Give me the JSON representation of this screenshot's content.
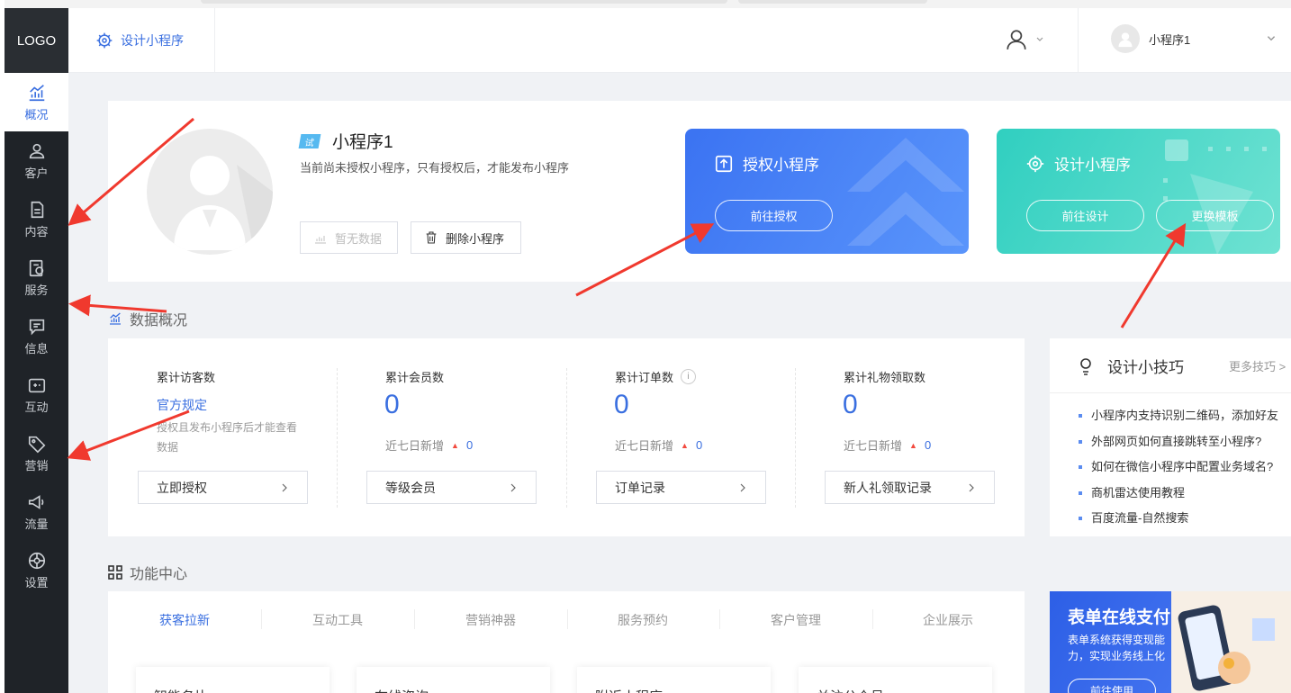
{
  "sidebar": {
    "logo": "LOGO",
    "items": [
      {
        "label": "概况",
        "icon": "chart-icon"
      },
      {
        "label": "客户",
        "icon": "user-icon"
      },
      {
        "label": "内容",
        "icon": "document-icon"
      },
      {
        "label": "服务",
        "icon": "service-icon"
      },
      {
        "label": "信息",
        "icon": "message-icon"
      },
      {
        "label": "互动",
        "icon": "interaction-icon"
      },
      {
        "label": "营销",
        "icon": "tag-icon"
      },
      {
        "label": "流量",
        "icon": "megaphone-icon"
      },
      {
        "label": "设置",
        "icon": "gear-icon"
      }
    ]
  },
  "header": {
    "tab_label": "设计小程序",
    "account_name": "小程序1"
  },
  "profile": {
    "badge": "试",
    "name": "小程序1",
    "desc": "当前尚未授权小程序，只有授权后，才能发布小程序",
    "nodata_label": "暂无数据",
    "delete_label": "删除小程序",
    "auth_card": {
      "title": "授权小程序",
      "button": "前往授权"
    },
    "design_card": {
      "title": "设计小程序",
      "button_design": "前往设计",
      "button_template": "更换模板"
    }
  },
  "data_overview": {
    "title": "数据概况",
    "stats": [
      {
        "label": "累计访客数",
        "rule_link": "官方规定",
        "rule_text": "授权且发布小程序后才能查看数据",
        "button": "立即授权"
      },
      {
        "label": "累计会员数",
        "value": "0",
        "sub": "近七日新增",
        "delta": "0",
        "button": "等级会员"
      },
      {
        "label": "累计订单数",
        "value": "0",
        "sub": "近七日新增",
        "delta": "0",
        "button": "订单记录",
        "info": "i"
      },
      {
        "label": "累计礼物领取数",
        "value": "0",
        "sub": "近七日新增",
        "delta": "0",
        "button": "新人礼领取记录"
      }
    ]
  },
  "tips": {
    "title": "设计小技巧",
    "more": "更多技巧 >",
    "items": [
      "小程序内支持识别二维码，添加好友",
      "外部网页如何直接跳转至小程序?",
      "如何在微信小程序中配置业务域名?",
      "商机雷达使用教程",
      "百度流量-自然搜索"
    ]
  },
  "function_center": {
    "title": "功能中心",
    "tabs": [
      "获客拉新",
      "互动工具",
      "营销神器",
      "服务预约",
      "客户管理",
      "企业展示"
    ],
    "cards": [
      "智能名片",
      "在线咨询",
      "附近小程序",
      "关注公众号"
    ]
  },
  "promo": {
    "title": "表单在线支付",
    "subtitle": "表单系统获得变现能力，实现业务线上化",
    "button": "前往使用"
  },
  "colors": {
    "sidebar_bg": "#1f2328",
    "accent": "#3a6fe0",
    "auth_card": "#3b73f2",
    "design_card": "#30cfc0",
    "annotation_arrow": "#f0392e",
    "delta_up": "#f24a3e"
  }
}
